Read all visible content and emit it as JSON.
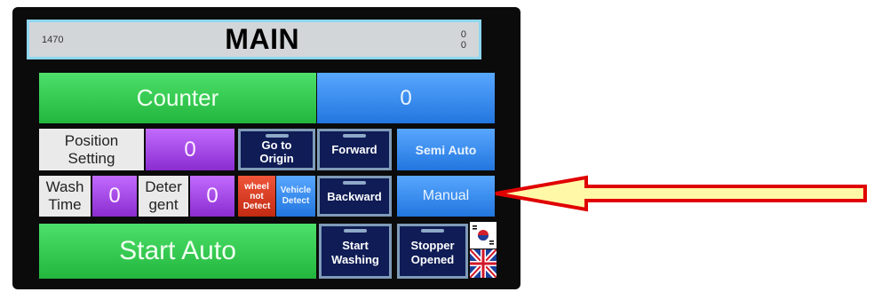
{
  "header": {
    "left_value": "1470",
    "title": "MAIN",
    "right_values": [
      "0",
      "0"
    ]
  },
  "row1": {
    "counter_label": "Counter",
    "counter_value": "0"
  },
  "row2": {
    "position_setting_label": [
      "Position",
      "Setting"
    ],
    "position_value": "0",
    "go_to_origin_label": [
      "Go to",
      "Origin"
    ],
    "forward_label": "Forward",
    "semi_auto_label": "Semi Auto"
  },
  "row3": {
    "wash_time_label": [
      "Wash",
      "Time"
    ],
    "wash_time_value": "0",
    "detergent_label": [
      "Deter",
      "gent"
    ],
    "detergent_value": "0",
    "wheel_not_detect_label": [
      "wheel",
      "not",
      "Detect"
    ],
    "vehicle_detect_label": [
      "Vehicle",
      "Detect"
    ],
    "backward_label": "Backward",
    "manual_label": "Manual"
  },
  "row4": {
    "start_auto_label": "Start Auto",
    "start_washing_label": [
      "Start",
      "Washing"
    ],
    "stopper_opened_label": [
      "Stopper",
      "Opened"
    ]
  },
  "colors": {
    "green": "#2fc94c",
    "blue": "#3f91f0",
    "purple": "#a844ea",
    "navy": "#0f1c55",
    "red": "#d9391e",
    "arrow_fill": "#fff8a6",
    "arrow_stroke": "#e00000"
  },
  "icons": [
    "korea-flag-icon",
    "uk-flag-icon",
    "annotation-arrow"
  ]
}
